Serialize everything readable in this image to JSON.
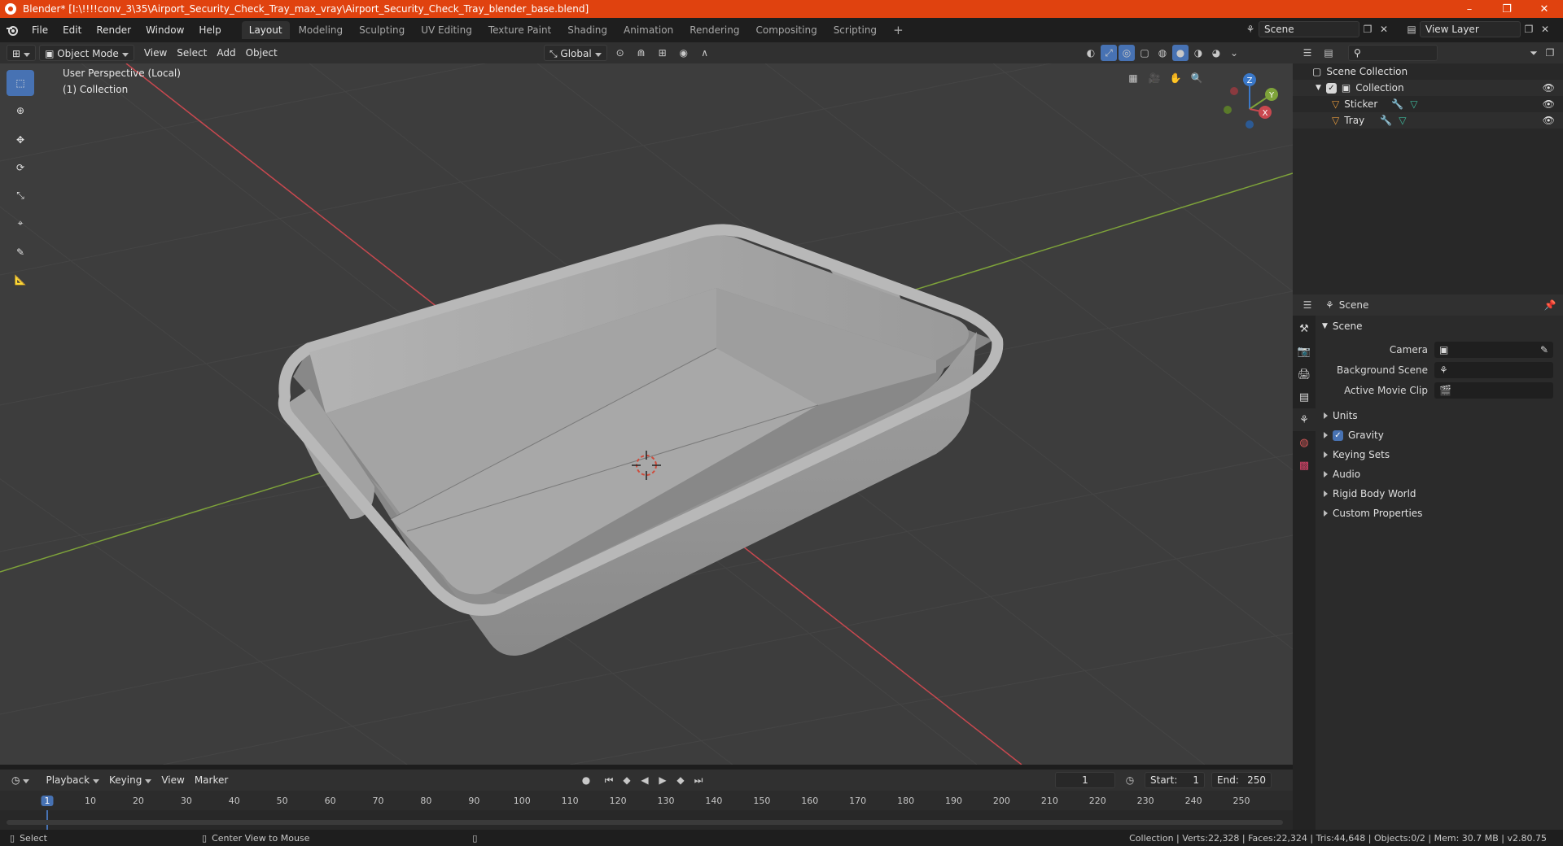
{
  "window": {
    "title": "Blender* [I:\\!!!!conv_3\\35\\Airport_Security_Check_Tray_max_vray\\Airport_Security_Check_Tray_blender_base.blend]",
    "minimize": "–",
    "restore": "❐",
    "close": "✕"
  },
  "menus": [
    "File",
    "Edit",
    "Render",
    "Window",
    "Help"
  ],
  "workspaces": [
    "Layout",
    "Modeling",
    "Sculpting",
    "UV Editing",
    "Texture Paint",
    "Shading",
    "Animation",
    "Rendering",
    "Compositing",
    "Scripting"
  ],
  "workspace_active": "Layout",
  "scene_field": "Scene",
  "view_layer_field": "View Layer",
  "viewport_header": {
    "mode": "Object Mode",
    "menus": [
      "View",
      "Select",
      "Add",
      "Object"
    ],
    "orientation": "Global"
  },
  "viewport": {
    "perspective_label": "User Perspective (Local)",
    "collection_label": "(1) Collection",
    "axes": {
      "x": "X",
      "y": "Y",
      "z": "Z"
    },
    "colors": {
      "bg": "#3d3d3d",
      "x_axis": "#c8484f",
      "y_axis": "#7ea33a",
      "z_axis": "#3a78c9",
      "tray": "#a9a9a9"
    }
  },
  "toolbar_icons": [
    "select-box-icon",
    "cursor-icon",
    "move-icon",
    "rotate-icon",
    "scale-icon",
    "transform-icon",
    "annotate-icon",
    "measure-icon"
  ],
  "outliner": {
    "root": "Scene Collection",
    "collection": "Collection",
    "objects": [
      "Sticker",
      "Tray"
    ]
  },
  "properties": {
    "header": "Scene",
    "section": "Scene",
    "rows": [
      {
        "label": "Camera",
        "value": ""
      },
      {
        "label": "Background Scene",
        "value": ""
      },
      {
        "label": "Active Movie Clip",
        "value": ""
      }
    ],
    "subsections": [
      "Units",
      "Gravity",
      "Keying Sets",
      "Audio",
      "Rigid Body World",
      "Custom Properties"
    ],
    "gravity_checked": true
  },
  "timeline": {
    "menus": [
      "Playback",
      "Keying",
      "View",
      "Marker"
    ],
    "current_frame": "1",
    "start_label": "Start:",
    "start": "1",
    "end_label": "End:",
    "end": "250",
    "ticks": [
      "1",
      "10",
      "20",
      "30",
      "40",
      "50",
      "60",
      "70",
      "80",
      "90",
      "100",
      "110",
      "120",
      "130",
      "140",
      "150",
      "160",
      "170",
      "180",
      "190",
      "200",
      "210",
      "220",
      "230",
      "240",
      "250"
    ]
  },
  "status": {
    "left_action": "Select",
    "mid_action": "Center View to Mouse",
    "stats": "Collection | Verts:22,328 | Faces:22,324 | Tris:44,648 | Objects:0/2 | Mem: 30.7 MB | v2.80.75"
  }
}
